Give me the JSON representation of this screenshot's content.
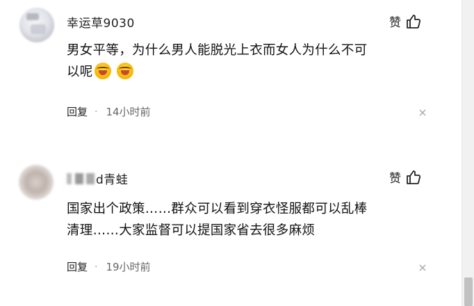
{
  "comments": [
    {
      "username": "幸运草9030",
      "like_label": "赞",
      "text_line1": "男女平等，为什么男人能脱光上衣而女人为什么不可",
      "text_line2": "以呢",
      "reply_label": "回复",
      "dot": "·",
      "time": "14小时前",
      "emoji_count": 2,
      "emoji_icon": "crying-laughing-emoji"
    },
    {
      "username": "d青蛙",
      "username_prefix_blurred": true,
      "like_label": "赞",
      "text_line1": "国家出个政策……群众可以看到穿衣怪服都可以乱棒",
      "text_line2": "清理……大家监督可以提国家省去很多麻烦",
      "reply_label": "回复",
      "dot": "·",
      "time": "19小时前"
    }
  ],
  "colors": {
    "background": "#ffffff",
    "text": "#111111",
    "muted": "#666666",
    "icon": "#222222"
  }
}
